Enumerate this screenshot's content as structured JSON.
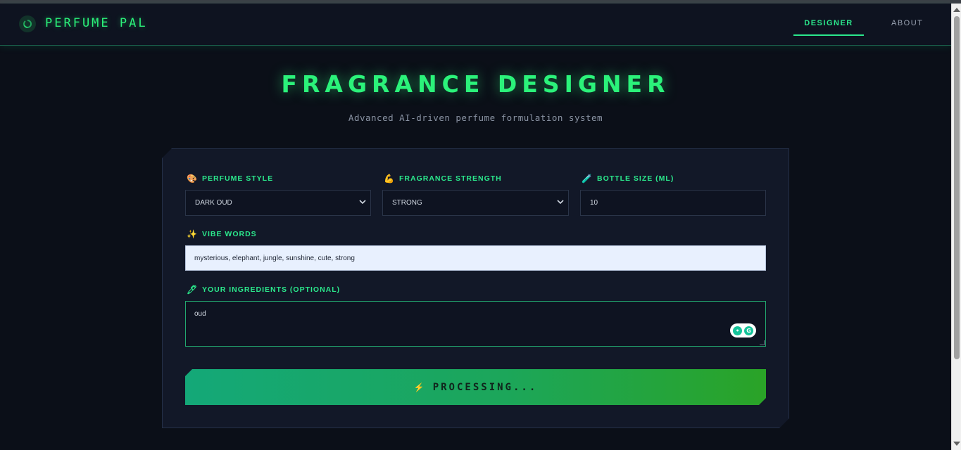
{
  "app": {
    "brand": "PERFUME PAL",
    "logo_icon": "spinner-icon"
  },
  "nav": {
    "items": [
      {
        "label": "DESIGNER",
        "active": true
      },
      {
        "label": "ABOUT",
        "active": false
      }
    ]
  },
  "hero": {
    "title": "FRAGRANCE DESIGNER",
    "subtitle": "Advanced AI-driven perfume formulation system"
  },
  "form": {
    "style": {
      "label": "PERFUME STYLE",
      "icon": "palette-icon",
      "value": "DARK OUD"
    },
    "strength": {
      "label": "FRAGRANCE STRENGTH",
      "icon": "flexed-bicep-icon",
      "value": "STRONG"
    },
    "bottle": {
      "label": "BOTTLE SIZE (ML)",
      "icon": "bottle-icon",
      "value": "10"
    },
    "vibe": {
      "label": "VIBE WORDS",
      "icon": "sparkles-icon",
      "value": "mysterious, elephant, jungle, sunshine, cute, strong"
    },
    "ingredients": {
      "label": "YOUR INGREDIENTS (OPTIONAL)",
      "icon": "test-tube-icon",
      "value": "oud"
    },
    "submit": {
      "label": "PROCESSING...",
      "icon": "lightning-icon"
    }
  },
  "colors": {
    "accent": "#2bf27a",
    "background": "#0b0f18",
    "card": "#121828"
  }
}
